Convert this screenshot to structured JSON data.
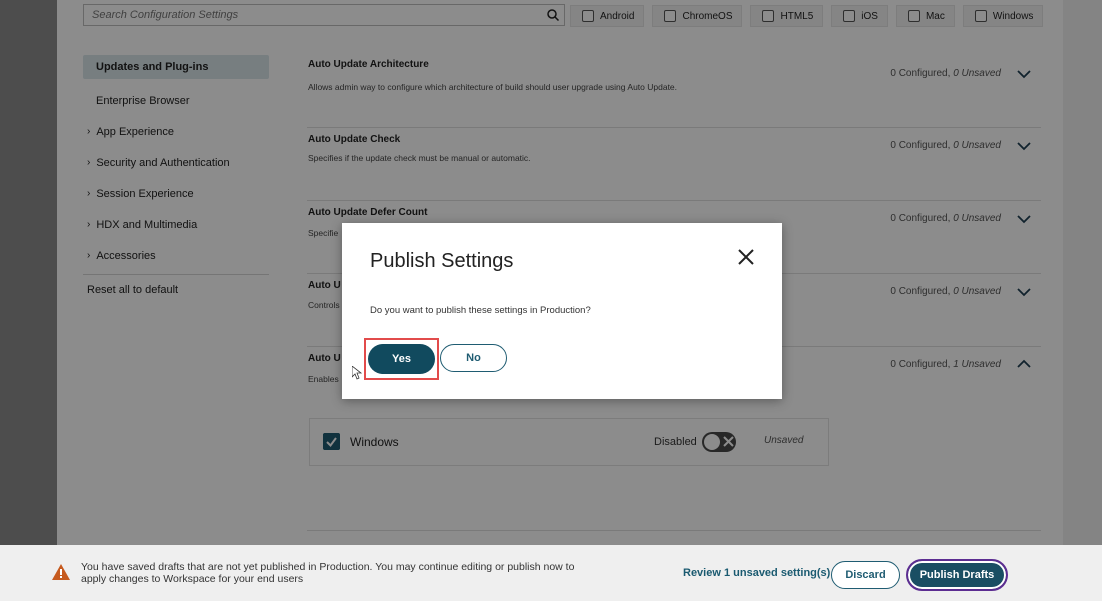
{
  "search": {
    "placeholder": "Search Configuration Settings"
  },
  "platforms": [
    {
      "label": "Android"
    },
    {
      "label": "ChromeOS"
    },
    {
      "label": "HTML5"
    },
    {
      "label": "iOS"
    },
    {
      "label": "Mac"
    },
    {
      "label": "Windows"
    }
  ],
  "nav": {
    "active": "Updates and Plug-ins",
    "child": "Enterprise Browser",
    "groups": [
      "App Experience",
      "Security and Authentication",
      "Session Experience",
      "HDX and Multimedia",
      "Accessories"
    ],
    "reset": "Reset all to default"
  },
  "settings": [
    {
      "title": "Auto Update Architecture",
      "desc": "Allows admin way to configure which architecture of build should user upgrade using Auto Update.",
      "configured": "0 Configured,",
      "unsaved": "0 Unsaved"
    },
    {
      "title": "Auto Update Check",
      "desc": "Specifies if the update check must be manual or automatic.",
      "configured": "0 Configured,",
      "unsaved": "0 Unsaved"
    },
    {
      "title": "Auto Update Defer Count",
      "desc": "Specifie",
      "configured": "0 Configured,",
      "unsaved": "0 Unsaved"
    },
    {
      "title": "Auto U",
      "desc": "Controls",
      "configured": "0 Configured,",
      "unsaved": "0 Unsaved"
    },
    {
      "title": "Auto U",
      "desc": "Enables",
      "configured": "0 Configured,",
      "unsaved": "1 Unsaved"
    }
  ],
  "windows_row": {
    "label": "Windows",
    "state": "Disabled",
    "status": "Unsaved"
  },
  "footer": {
    "message": "You have saved drafts that are not yet published in Production. You may continue editing or publish now to apply changes to Workspace for your end users",
    "review": "Review 1 unsaved setting(s)",
    "discard": "Discard",
    "publish": "Publish Drafts"
  },
  "modal": {
    "title": "Publish Settings",
    "text": "Do you want to publish these settings in Production?",
    "yes": "Yes",
    "no": "No"
  },
  "colors": {
    "primary": "#114a5e",
    "highlight": "#e24b4b",
    "active_nav": "#d9e6ea"
  }
}
